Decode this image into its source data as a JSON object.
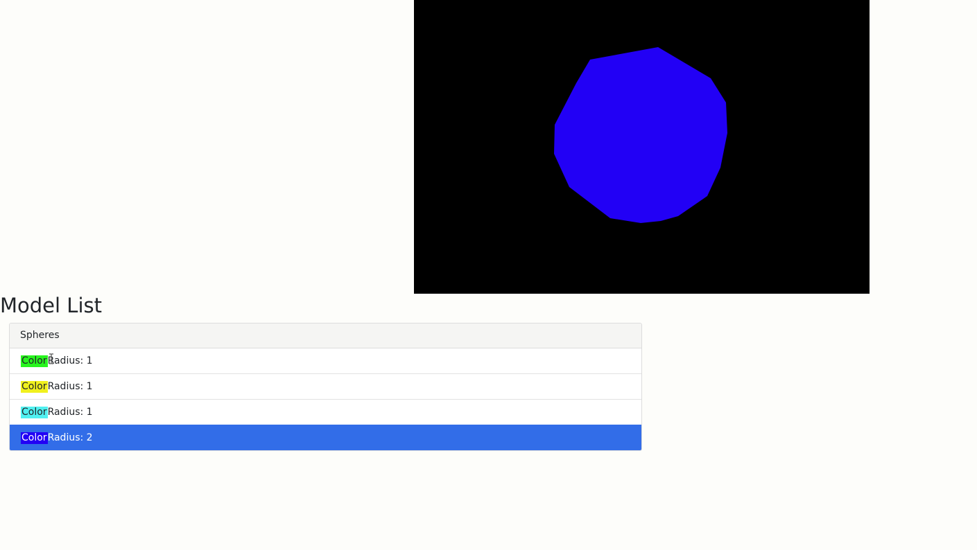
{
  "viewport": {
    "background": "#000000",
    "sphere_color": "#2200f5"
  },
  "page": {
    "title": "Model List"
  },
  "panel": {
    "header": "Spheres",
    "selected_index": 3,
    "items": [
      {
        "swatch_label": "Color",
        "swatch_color": "#28f51e",
        "text": "Radius: 1"
      },
      {
        "swatch_label": "Color",
        "swatch_color": "#f0f01e",
        "text": "Radius: 1"
      },
      {
        "swatch_label": "Color",
        "swatch_color": "#50f0f0",
        "text": "Radius: 1"
      },
      {
        "swatch_label": "Color",
        "swatch_color": "#2200f5",
        "text": "Radius: 2"
      }
    ]
  },
  "colors": {
    "active_row": "#326de8",
    "page_background": "#fdfdfa"
  }
}
